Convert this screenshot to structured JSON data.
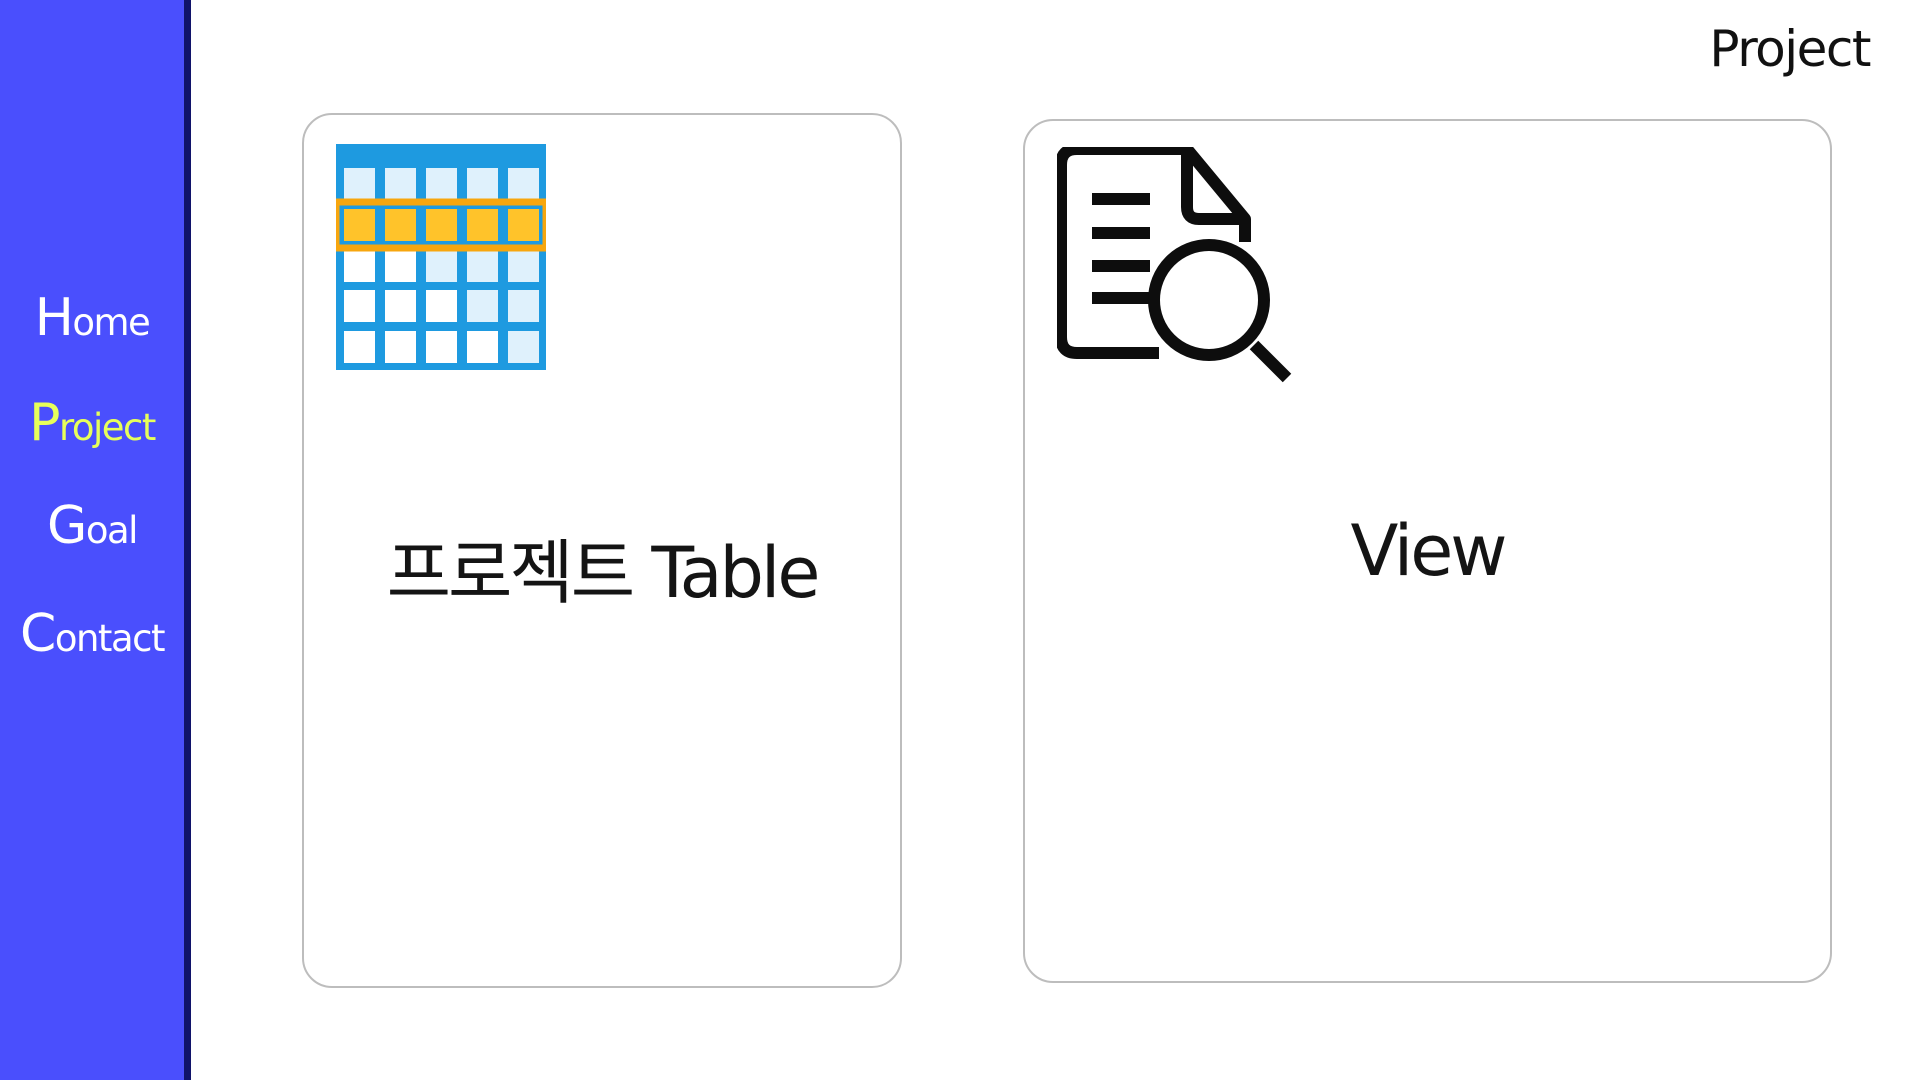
{
  "page_title": "Project",
  "sidebar": {
    "items": [
      {
        "cap": "H",
        "rest": "ome",
        "active": false
      },
      {
        "cap": "P",
        "rest": "roject",
        "active": true
      },
      {
        "cap": "G",
        "rest": "oal",
        "active": false
      },
      {
        "cap": "C",
        "rest": "ontact",
        "active": false
      }
    ]
  },
  "cards": [
    {
      "label": "프로젝트 Table",
      "icon": "table-icon"
    },
    {
      "label": "View",
      "icon": "document-search-icon"
    }
  ],
  "colors": {
    "sidebar_bg": "#4a4ffd",
    "sidebar_border": "#10136a",
    "nav_text": "#ffffff",
    "nav_active": "#e7ff5a",
    "card_border": "#bdbdbd",
    "table_blue": "#1e9ae0",
    "table_highlight": "#f7a60e"
  }
}
